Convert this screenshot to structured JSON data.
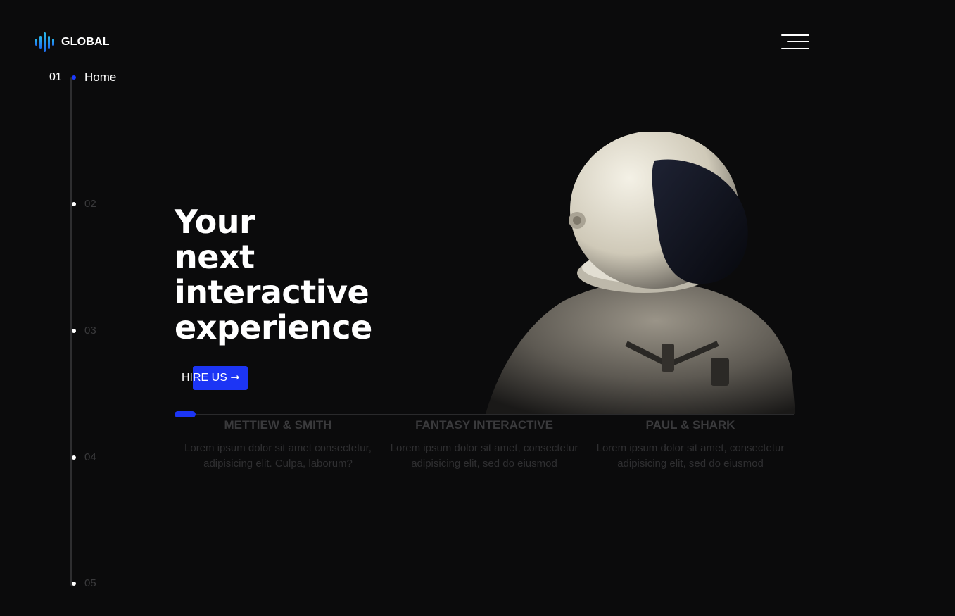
{
  "brand": {
    "name": "GLOBAL",
    "accent_color": "#1c35f5",
    "logo_gradient": [
      "#29b8e8",
      "#1e6cf0"
    ]
  },
  "header": {
    "menu_icon": "hamburger-menu-icon"
  },
  "nav": {
    "items": [
      {
        "num": "01",
        "label": "Home"
      },
      {
        "num": "",
        "label": "02"
      },
      {
        "num": "",
        "label": "03"
      },
      {
        "num": "",
        "label": "04"
      },
      {
        "num": "",
        "label": "05"
      }
    ]
  },
  "hero": {
    "title_lines": [
      "Your",
      "next",
      "interactive",
      "experience"
    ],
    "cta_label": "HIRE US ➞"
  },
  "clients": [
    {
      "name": "METTIEW & SMITH",
      "description": "Lorem ipsum dolor sit amet consectetur, adipisicing elit. Culpa, laborum?"
    },
    {
      "name": "FANTASY INTERACTIVE",
      "description": "Lorem ipsum dolor sit amet, consectetur adipisicing elit, sed do eiusmod"
    },
    {
      "name": "PAUL & SHARK",
      "description": "Lorem ipsum dolor sit amet, consectetur adipisicing elit, sed do eiusmod"
    }
  ]
}
